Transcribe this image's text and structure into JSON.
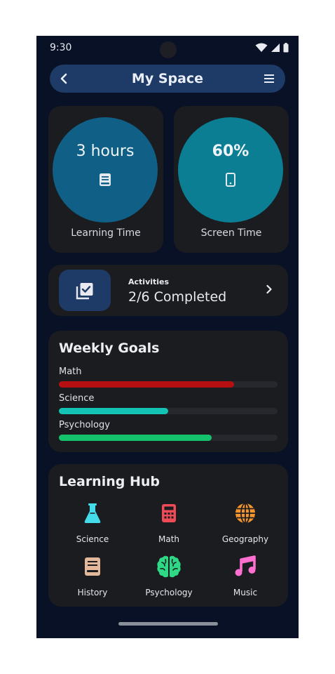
{
  "status_bar": {
    "time": "9:30"
  },
  "app_bar": {
    "title": "My Space",
    "back_icon": "chevron-left-icon",
    "menu_icon": "hamburger-menu-icon"
  },
  "stats": [
    {
      "value": "3 hours",
      "label": "Learning Time",
      "icon": "book-icon",
      "color": "#0f5f86"
    },
    {
      "value": "60%",
      "label": "Screen Time",
      "icon": "phone-icon",
      "color": "#0b7e93"
    }
  ],
  "activities": {
    "label": "Activities",
    "value": "2/6 Completed",
    "icon": "library-add-check-icon"
  },
  "weekly_goals": {
    "title": "Weekly Goals",
    "goals": [
      {
        "name": "Math",
        "progress": 0.8,
        "color": "#b50f12"
      },
      {
        "name": "Science",
        "progress": 0.5,
        "color": "#13c4b4"
      },
      {
        "name": "Psychology",
        "progress": 0.7,
        "color": "#13c26a"
      }
    ]
  },
  "learning_hub": {
    "title": "Learning Hub",
    "items": [
      {
        "label": "Science",
        "icon": "flask-icon",
        "color": "#44dcea"
      },
      {
        "label": "Math",
        "icon": "calculator-icon",
        "color": "#ef4b57"
      },
      {
        "label": "Geography",
        "icon": "globe-icon",
        "color": "#f5962a"
      },
      {
        "label": "History",
        "icon": "book-icon",
        "color": "#e2b79a"
      },
      {
        "label": "Psychology",
        "icon": "brain-icon",
        "color": "#2fd884"
      },
      {
        "label": "Music",
        "icon": "music-note-icon",
        "color": "#ff6fd0"
      }
    ]
  }
}
